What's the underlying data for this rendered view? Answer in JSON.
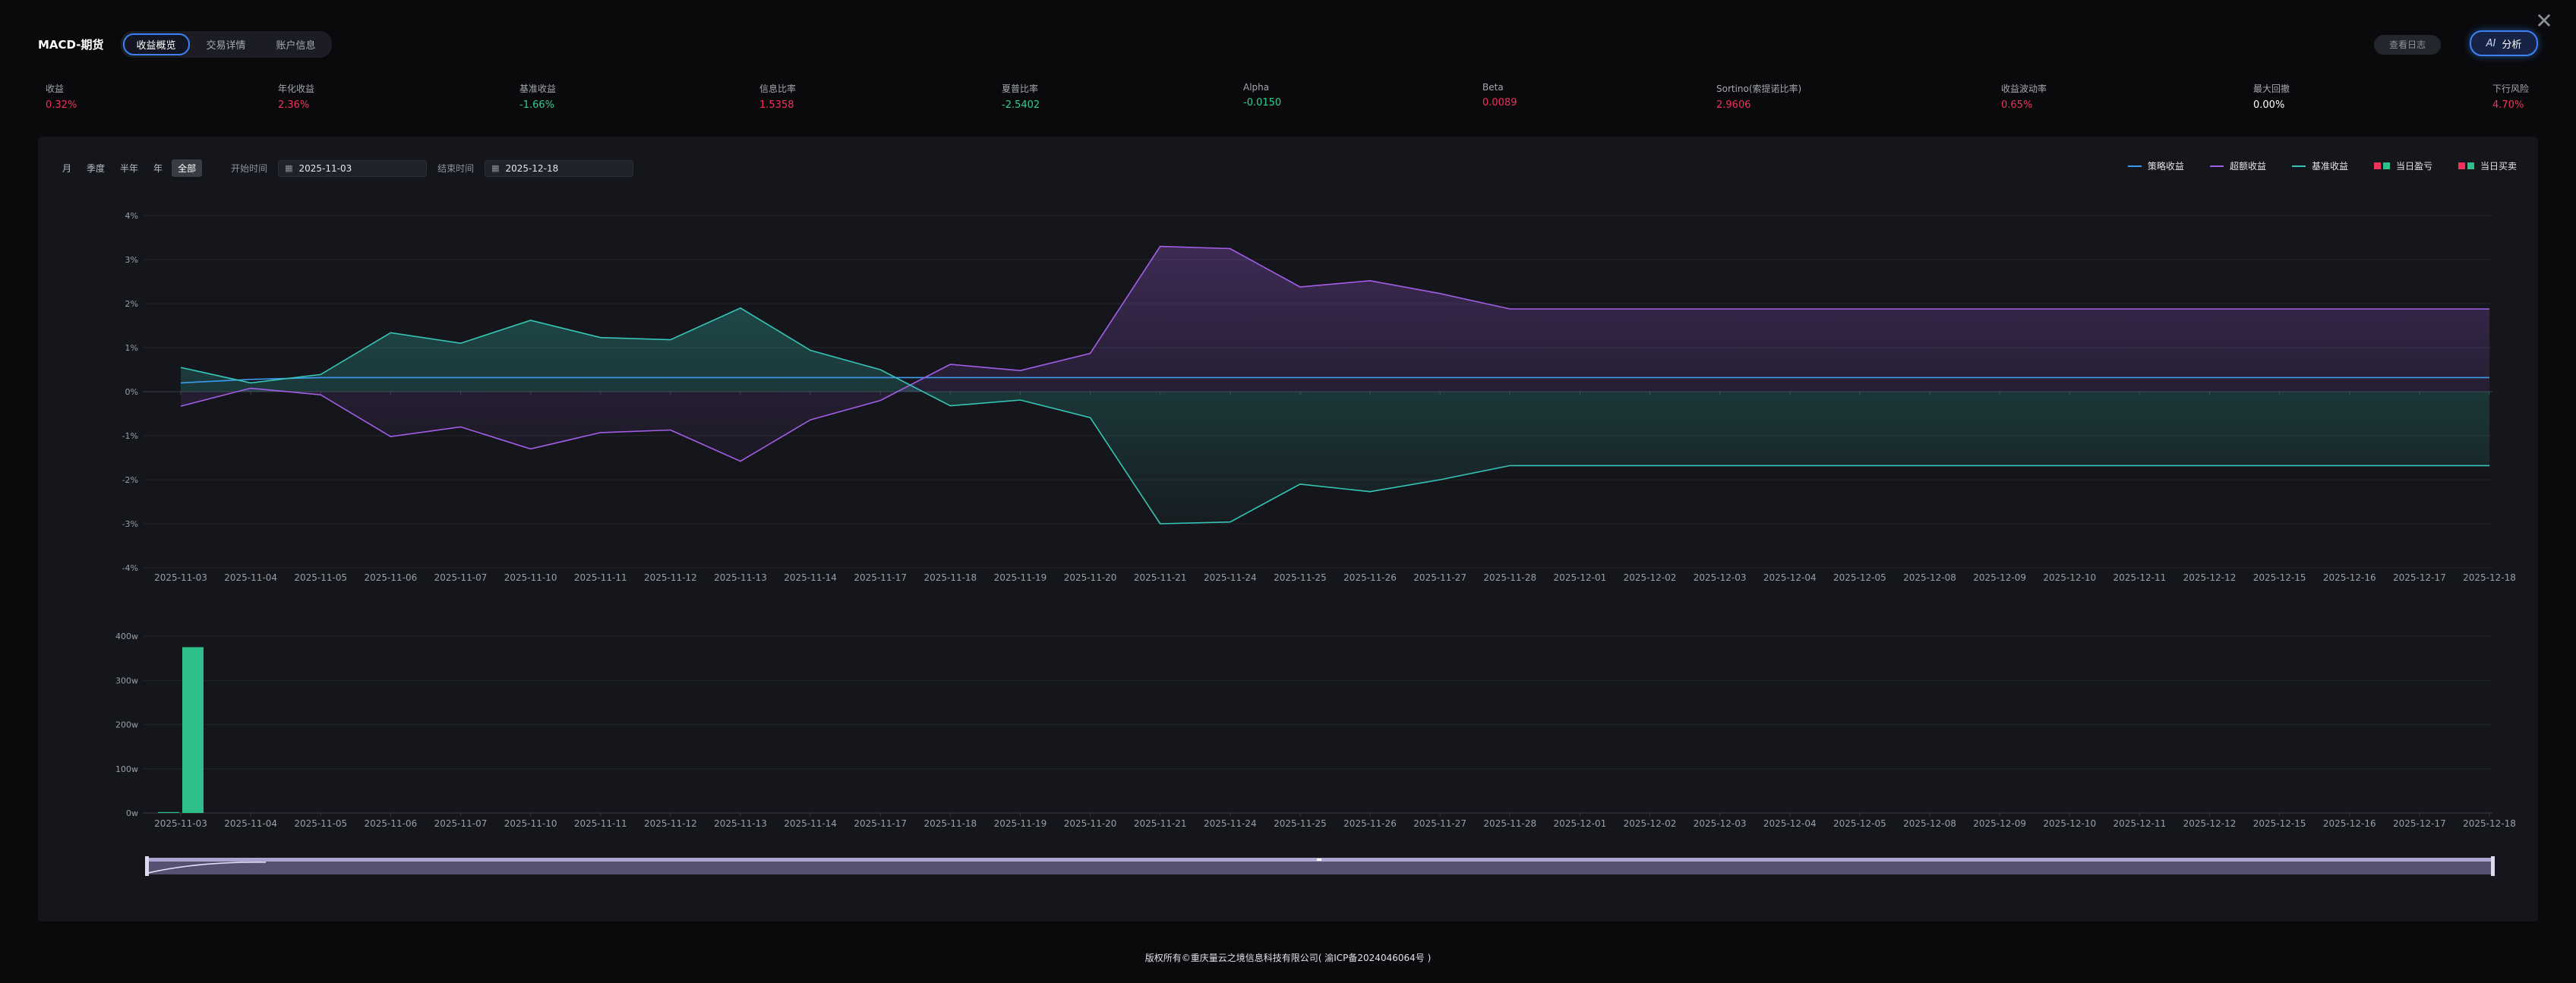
{
  "window": {
    "close_glyph": "✕"
  },
  "header": {
    "strategy_name": "MACD-期货",
    "tabs": [
      {
        "label": "收益概览",
        "active": true
      },
      {
        "label": "交易详情",
        "active": false
      },
      {
        "label": "账户信息",
        "active": false
      }
    ],
    "log_button": "查看日志",
    "ai_button": {
      "icon": "AI",
      "label": "分析"
    }
  },
  "metrics": [
    {
      "label": "收益",
      "value": "0.32%",
      "tone": "red"
    },
    {
      "label": "年化收益",
      "value": "2.36%",
      "tone": "red"
    },
    {
      "label": "基准收益",
      "value": "-1.66%",
      "tone": "green"
    },
    {
      "label": "信息比率",
      "value": "1.5358",
      "tone": "red"
    },
    {
      "label": "夏普比率",
      "value": "-2.5402",
      "tone": "green"
    },
    {
      "label": "Alpha",
      "value": "-0.0150",
      "tone": "green"
    },
    {
      "label": "Beta",
      "value": "0.0089",
      "tone": "red"
    },
    {
      "label": "Sortino(索提诺比率)",
      "value": "2.9606",
      "tone": "red"
    },
    {
      "label": "收益波动率",
      "value": "0.65%",
      "tone": "red"
    },
    {
      "label": "最大回撤",
      "value": "0.00%",
      "tone": "white"
    },
    {
      "label": "下行风险",
      "value": "4.70%",
      "tone": "red"
    }
  ],
  "toolbar": {
    "periods": [
      {
        "label": "月",
        "active": false
      },
      {
        "label": "季度",
        "active": false
      },
      {
        "label": "半年",
        "active": false
      },
      {
        "label": "年",
        "active": false
      },
      {
        "label": "全部",
        "active": true
      }
    ],
    "start_label": "开始时间",
    "start_value": "2025-11-03",
    "end_label": "结束时间",
    "end_value": "2025-12-18"
  },
  "legend": [
    {
      "label": "策略收益",
      "type": "line",
      "color": "#3d9bf0"
    },
    {
      "label": "超额收益",
      "type": "line",
      "color": "#a35ee8"
    },
    {
      "label": "基准收益",
      "type": "line",
      "color": "#35c6b8"
    },
    {
      "label": "当日盈亏",
      "type": "bar",
      "colors": [
        "#f0325a",
        "#2dbf8a"
      ]
    },
    {
      "label": "当日买卖",
      "type": "bar",
      "colors": [
        "#f0325a",
        "#2dbf8a"
      ]
    }
  ],
  "chart_data": [
    {
      "type": "line",
      "x": [
        "2025-11-03",
        "2025-11-04",
        "2025-11-05",
        "2025-11-06",
        "2025-11-07",
        "2025-11-10",
        "2025-11-11",
        "2025-11-12",
        "2025-11-13",
        "2025-11-14",
        "2025-11-17",
        "2025-11-18",
        "2025-11-19",
        "2025-11-20",
        "2025-11-21",
        "2025-11-24",
        "2025-11-25",
        "2025-11-26",
        "2025-11-27",
        "2025-11-28",
        "2025-12-01",
        "2025-12-02",
        "2025-12-03",
        "2025-12-04",
        "2025-12-05",
        "2025-12-08",
        "2025-12-09",
        "2025-12-10",
        "2025-12-11",
        "2025-12-12",
        "2025-12-15",
        "2025-12-16",
        "2025-12-17",
        "2025-12-18"
      ],
      "yticks": [
        "4%",
        "3%",
        "2%",
        "1%",
        "0%",
        "-1%",
        "-2%",
        "-3%",
        "-4%"
      ],
      "ylim": [
        -4,
        4
      ],
      "series": [
        {
          "name": "策略收益",
          "color": "#3d9bf0",
          "values": [
            0.2,
            0.28,
            0.32,
            0.32,
            0.32,
            0.32,
            0.32,
            0.32,
            0.32,
            0.32,
            0.32,
            0.32,
            0.32,
            0.32,
            0.32,
            0.32,
            0.32,
            0.32,
            0.32,
            0.32,
            0.32,
            0.32,
            0.32,
            0.32,
            0.32,
            0.32,
            0.32,
            0.32,
            0.32,
            0.32,
            0.32,
            0.32,
            0.32,
            0.32
          ]
        },
        {
          "name": "超额收益",
          "color": "#a35ee8",
          "values": [
            -0.33,
            0.08,
            -0.07,
            -1.02,
            -0.8,
            -1.3,
            -0.93,
            -0.87,
            -1.58,
            -0.64,
            -0.2,
            0.62,
            0.48,
            0.87,
            3.3,
            3.25,
            2.38,
            2.52,
            2.23,
            1.88,
            1.88,
            1.88,
            1.88,
            1.88,
            1.88,
            1.88,
            1.88,
            1.88,
            1.88,
            1.88,
            1.88,
            1.88,
            1.88,
            1.88
          ]
        },
        {
          "name": "基准收益",
          "color": "#35c6b8",
          "values": [
            0.55,
            0.2,
            0.39,
            1.34,
            1.1,
            1.62,
            1.23,
            1.18,
            1.9,
            0.94,
            0.5,
            -0.32,
            -0.19,
            -0.59,
            -3.0,
            -2.96,
            -2.1,
            -2.27,
            -2.0,
            -1.68,
            -1.68,
            -1.68,
            -1.68,
            -1.68,
            -1.68,
            -1.68,
            -1.68,
            -1.68,
            -1.68,
            -1.68,
            -1.68,
            -1.68,
            -1.68,
            -1.68
          ]
        }
      ]
    },
    {
      "type": "bar",
      "x": [
        "2025-11-03",
        "2025-11-04",
        "2025-11-05",
        "2025-11-06",
        "2025-11-07",
        "2025-11-10",
        "2025-11-11",
        "2025-11-12",
        "2025-11-13",
        "2025-11-14",
        "2025-11-17",
        "2025-11-18",
        "2025-11-19",
        "2025-11-20",
        "2025-11-21",
        "2025-11-24",
        "2025-11-25",
        "2025-11-26",
        "2025-11-27",
        "2025-11-28",
        "2025-12-01",
        "2025-12-02",
        "2025-12-03",
        "2025-12-04",
        "2025-12-05",
        "2025-12-08",
        "2025-12-09",
        "2025-12-10",
        "2025-12-11",
        "2025-12-12",
        "2025-12-15",
        "2025-12-16",
        "2025-12-17",
        "2025-12-18"
      ],
      "yticks": [
        "400w",
        "300w",
        "200w",
        "100w",
        "0w"
      ],
      "ylim": [
        0,
        400
      ],
      "unit": "w",
      "series": [
        {
          "name": "当日盈亏",
          "color": "#2dbf8a",
          "values": [
            2,
            0,
            0,
            0,
            0,
            0,
            0,
            0,
            0,
            0,
            0,
            0,
            0,
            0,
            0,
            0,
            0,
            0,
            0,
            0,
            0,
            0,
            0,
            0,
            0,
            0,
            0,
            0,
            0,
            0,
            0,
            0,
            0,
            0
          ]
        },
        {
          "name": "当日买卖",
          "color": "#2dbf8a",
          "values": [
            375,
            0,
            0,
            0,
            0,
            0,
            0,
            0,
            0,
            0,
            0,
            0,
            0,
            0,
            0,
            0,
            0,
            0,
            0,
            0,
            0,
            0,
            0,
            0,
            0,
            0,
            0,
            0,
            0,
            0,
            0,
            0,
            0,
            0
          ]
        }
      ]
    }
  ],
  "footer": "版权所有©重庆量云之境信息科技有限公司( 渝ICP备2024046064号 )"
}
